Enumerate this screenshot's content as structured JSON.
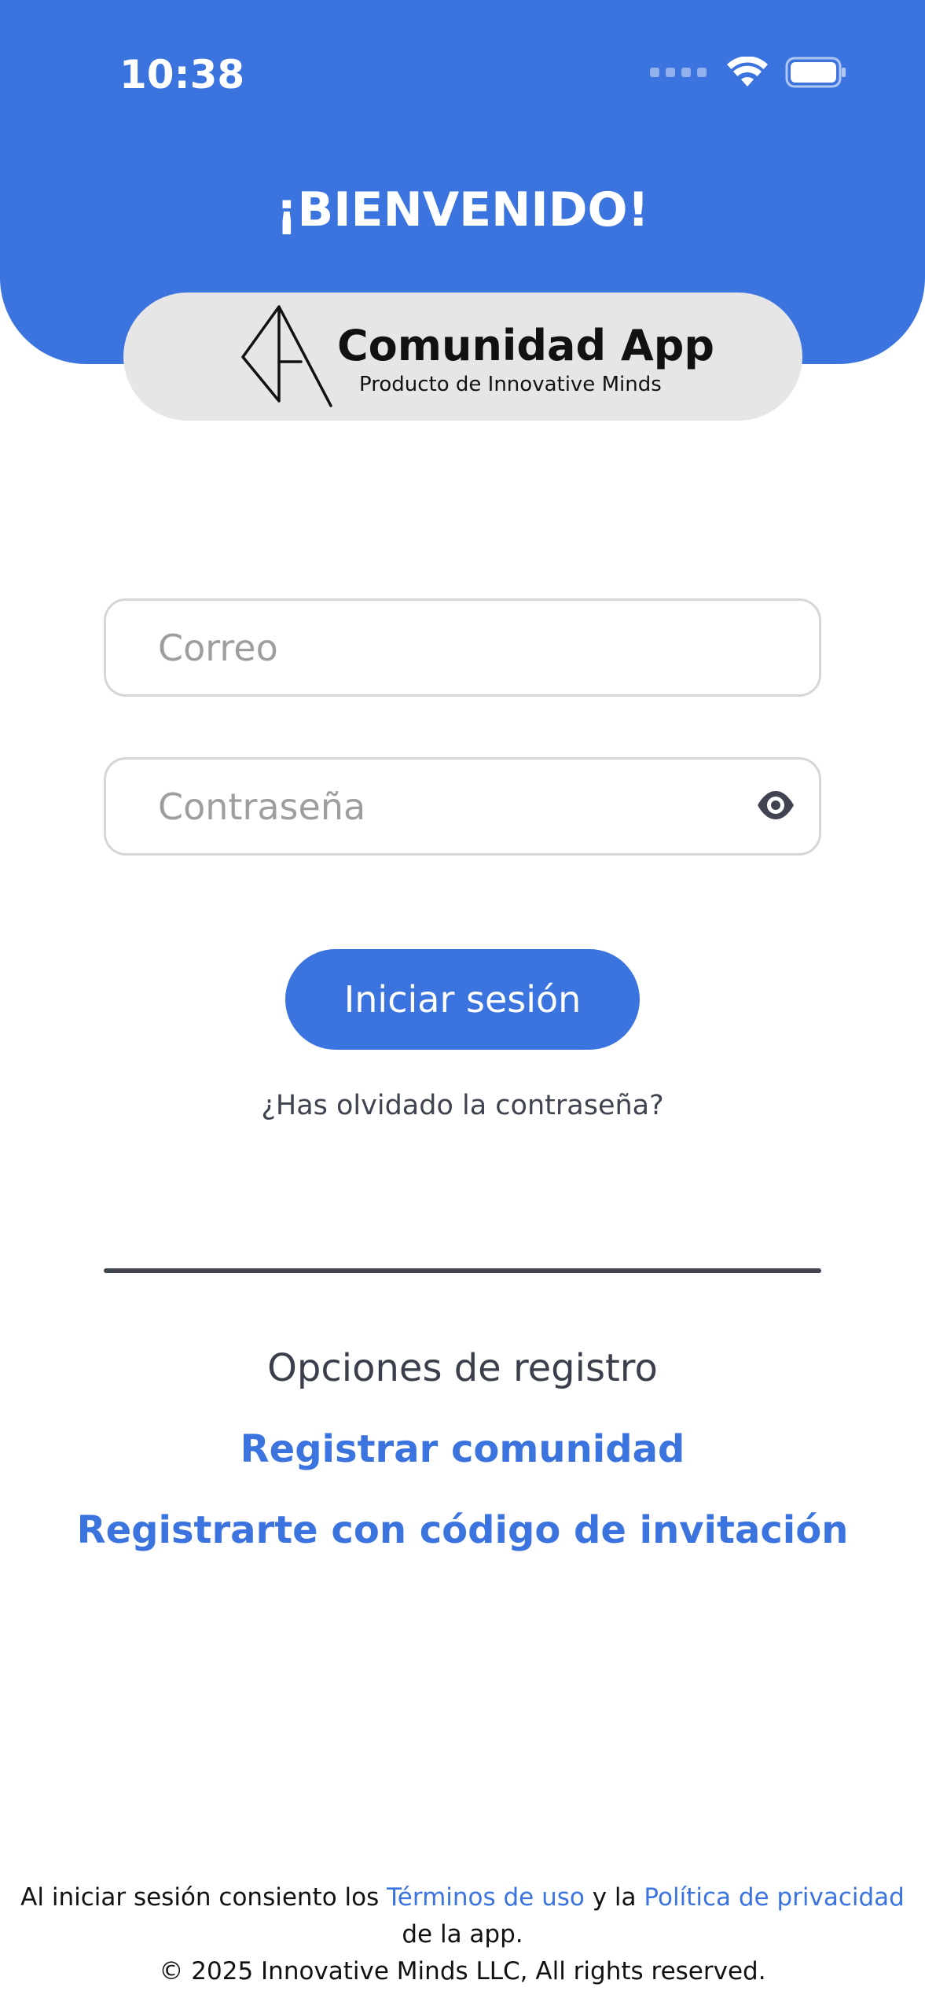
{
  "status_bar": {
    "time": "10:38"
  },
  "header": {
    "welcome": "¡BIENVENIDO!"
  },
  "logo": {
    "title": "Comunidad App",
    "subtitle": "Producto de Innovative Minds"
  },
  "form": {
    "email_placeholder": "Correo",
    "password_placeholder": "Contraseña",
    "login_label": "Iniciar sesión",
    "forgot_label": "¿Has olvidado la contraseña?"
  },
  "registration": {
    "title": "Opciones de registro",
    "register_community": "Registrar comunidad",
    "register_invite": "Registrarte con código de invitación"
  },
  "footer": {
    "line1_prefix": "Al iniciar sesión consiento los ",
    "terms_link": "Términos de uso",
    "line1_middle": " y la ",
    "privacy_link": "Política de privacidad",
    "line2": "de la app.",
    "copyright": "© 2025 Innovative Minds LLC, All rights reserved."
  },
  "colors": {
    "primary": "#3B73DF",
    "logo_background": "#E6E6E6",
    "field_border": "#D6D6D6",
    "text_dark": "#3F4450"
  }
}
